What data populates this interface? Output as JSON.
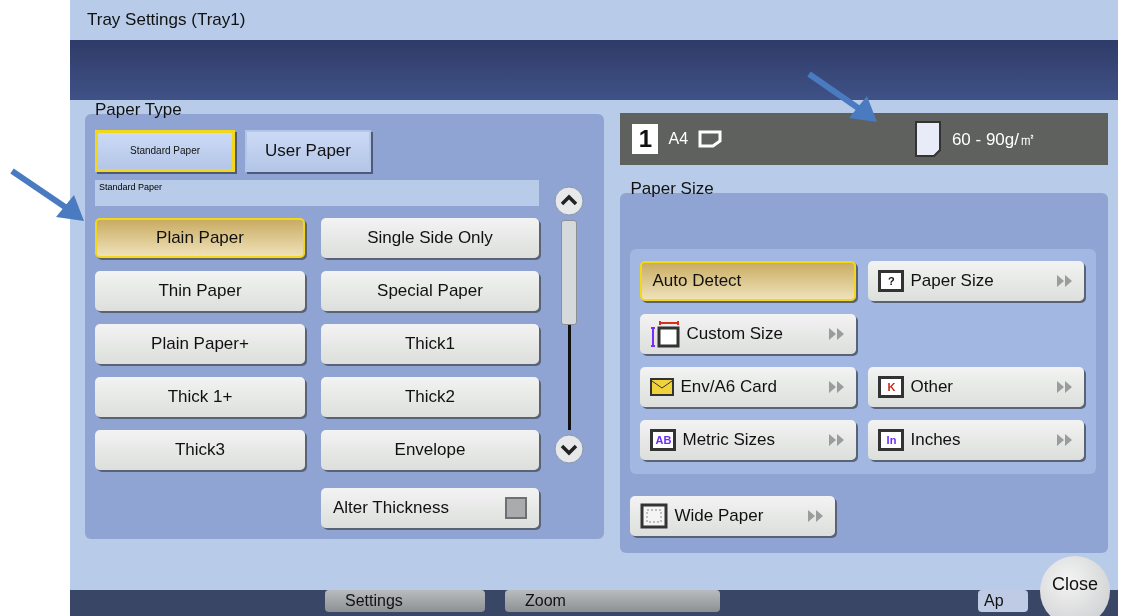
{
  "window": {
    "title": "Tray Settings (Tray1)"
  },
  "paper_type": {
    "label": "Paper Type",
    "tabs": [
      {
        "label": "Standard Paper",
        "selected": true
      },
      {
        "label": "User Paper",
        "selected": false
      }
    ],
    "category": "Standard Paper",
    "options": [
      {
        "label": "Plain Paper",
        "selected": true
      },
      {
        "label": "Single Side Only",
        "selected": false
      },
      {
        "label": "Thin Paper",
        "selected": false
      },
      {
        "label": "Special Paper",
        "selected": false
      },
      {
        "label": "Plain Paper+",
        "selected": false
      },
      {
        "label": "Thick1",
        "selected": false
      },
      {
        "label": "Thick 1+",
        "selected": false
      },
      {
        "label": "Thick2",
        "selected": false
      },
      {
        "label": "Thick3",
        "selected": false
      },
      {
        "label": "Envelope",
        "selected": false
      }
    ],
    "alter_thickness": {
      "label": "Alter Thickness",
      "checked": false
    }
  },
  "tray_info": {
    "tray": "1",
    "size": "A4",
    "weight": "60 - 90g/㎡"
  },
  "paper_size": {
    "label": "Paper Size",
    "rows": [
      {
        "options": [
          {
            "label": "Auto Detect",
            "selected": true,
            "kind": "plain",
            "submenu": false
          },
          {
            "label": "Paper Size",
            "selected": false,
            "kind": "question",
            "badge": "?",
            "submenu": true
          }
        ]
      },
      {
        "options": [
          {
            "label": "Custom Size",
            "selected": false,
            "kind": "custom",
            "submenu": true
          }
        ]
      },
      {
        "options": [
          {
            "label": "Env/A6 Card",
            "selected": false,
            "kind": "envelope",
            "submenu": true
          },
          {
            "label": "Other",
            "selected": false,
            "kind": "badge",
            "badge": "K",
            "submenu": true
          }
        ]
      },
      {
        "options": [
          {
            "label": "Metric Sizes",
            "selected": false,
            "kind": "badge",
            "badge": "AB",
            "submenu": true
          },
          {
            "label": "Inches",
            "selected": false,
            "kind": "badge",
            "badge": "In",
            "submenu": true
          }
        ]
      }
    ],
    "wide_paper": {
      "label": "Wide Paper",
      "selected": false,
      "submenu": true
    }
  },
  "bottom_bar": [
    "Settings",
    "Zoom",
    "Ap"
  ],
  "close": "Close"
}
